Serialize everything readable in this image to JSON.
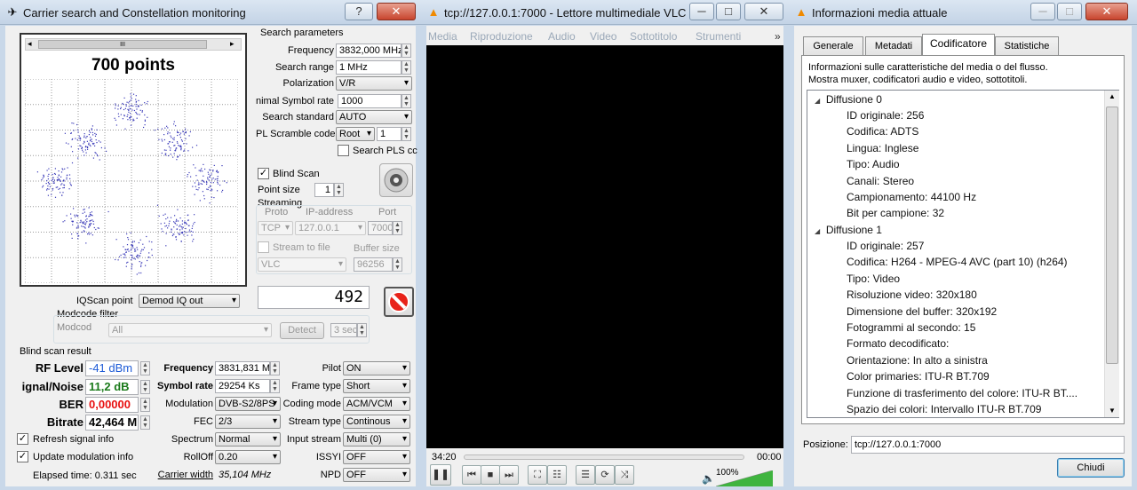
{
  "csw": {
    "title": "Carrier search and Constellation monitoring",
    "help_btn": "?",
    "close_btn": "✕",
    "points_label": "700 points",
    "scroll_grip": "III",
    "params": {
      "group_title": "Search parameters",
      "frequency_label": "Frequency",
      "frequency_value": "3832,000 MHz",
      "range_label": "Search range",
      "range_value": "1 MHz",
      "polarization_label": "Polarization",
      "polarization_value": "V/R",
      "symbol_label": "nimal Symbol rate",
      "symbol_value": "1000",
      "standard_label": "Search standard",
      "standard_value": "AUTO",
      "pls_label": "PL Scramble code",
      "pls_sel": "Root",
      "pls_value": "1",
      "search_pls_label": "Search PLS cc"
    },
    "blind_scan_label": "Blind Scan",
    "point_size_label": "Point size",
    "point_size_value": "1",
    "streaming": {
      "label": "Streaming",
      "proto_label": "Proto",
      "ip_label": "IP-address",
      "port_label": "Port",
      "proto_value": "TCP",
      "ip_value": "127.0.0.1",
      "port_value": "7000",
      "stream_to_file_label": "Stream to file",
      "buffer_label": "Buffer size",
      "player_value": "VLC",
      "buffer_value": "96256"
    },
    "counter_value": "492",
    "iqscan_label": "IQScan point",
    "iqscan_value": "Demod IQ out",
    "modcode_group": "Modcode filter",
    "modcode_label": "Modcod",
    "modcode_value": "All",
    "detect_btn": "Detect",
    "sec_value": "3 sec",
    "result_title": "Blind scan result",
    "rf_label": "RF Level",
    "rf_value": "-41 dBm",
    "sn_label": "ignal/Noise",
    "sn_value": "11,2 dB",
    "ber_label": "BER",
    "ber_value": "0,00000",
    "bitrate_label": "Bitrate",
    "bitrate_value": "42,464 M",
    "res_freq_label": "Frequency",
    "res_freq_value": "3831,831 M",
    "res_sr_label": "Symbol rate",
    "res_sr_value": "29254 Ks",
    "mod_label": "Modulation",
    "mod_value": "DVB-S2/8PS",
    "fec_label": "FEC",
    "fec_value": "2/3",
    "spectrum_label": "Spectrum",
    "spectrum_value": "Normal",
    "rolloff_label": "RollOff",
    "rolloff_value": "0.20",
    "carrier_width_label": "Carrier width",
    "carrier_width_value": "35,104 MHz",
    "pilot_label": "Pilot",
    "pilot_value": "ON",
    "frame_label": "Frame type",
    "frame_value": "Short",
    "coding_label": "Coding mode",
    "coding_value": "ACM/VCM",
    "stream_type_label": "Stream type",
    "stream_type_value": "Continous",
    "input_stream_label": "Input stream",
    "input_stream_value": "Multi (0)",
    "issyi_label": "ISSYI",
    "issyi_value": "OFF",
    "npd_label": "NPD",
    "npd_value": "OFF",
    "refresh_label": "Refresh signal info",
    "update_label": "Update modulation info",
    "elapsed_label": "Elapsed time: 0.311 sec"
  },
  "vlc": {
    "title": "tcp://127.0.0.1:7000 - Lettore multimediale VLC",
    "menu": [
      "Media",
      "Riproduzione",
      "Audio",
      "Video",
      "Sottotitolo",
      "Strumenti"
    ],
    "menu_more": "»",
    "time_elapsed": "34:20",
    "time_total": "00:00",
    "volume": "100%",
    "volume_level": 1.0
  },
  "info": {
    "title": "Informazioni media attuale",
    "tabs": [
      "Generale",
      "Metadati",
      "Codificatore",
      "Statistiche"
    ],
    "description": "Informazioni sulle caratteristiche del media o del flusso.\nMostra muxer, codificatori audio e video, sottotitoli.",
    "stream0": {
      "header": "Diffusione 0",
      "rows": [
        "ID originale: 256",
        "Codifica: ADTS",
        "Lingua: Inglese",
        "Tipo: Audio",
        "Canali: Stereo",
        "Campionamento: 44100 Hz",
        "Bit per campione: 32"
      ]
    },
    "stream1": {
      "header": "Diffusione 1",
      "rows": [
        "ID originale: 257",
        "Codifica: H264 - MPEG-4 AVC (part 10) (h264)",
        "Tipo: Video",
        "Risoluzione video: 320x180",
        "Dimensione del buffer: 320x192",
        "Fotogrammi al secondo: 15",
        "Formato decodificato:",
        "Orientazione: In alto a sinistra",
        "Color primaries: ITU-R BT.709",
        "Funzione di trasferimento del colore: ITU-R BT....",
        "Spazio dei colori: Intervallo ITU-R BT.709"
      ]
    },
    "position_label": "Posizione:",
    "position_value": "tcp://127.0.0.1:7000",
    "close_btn": "Chiudi"
  }
}
